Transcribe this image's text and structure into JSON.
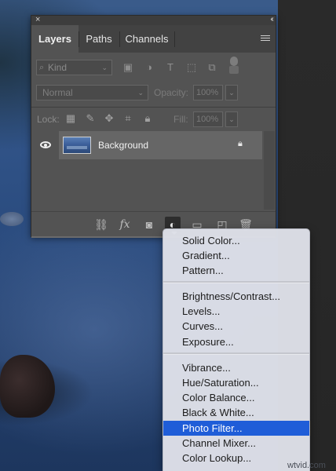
{
  "panel": {
    "close_glyph": "×",
    "collapse_glyph": "‹‹",
    "tabs": [
      {
        "label": "Layers",
        "active": true
      },
      {
        "label": "Paths",
        "active": false
      },
      {
        "label": "Channels",
        "active": false
      }
    ],
    "filter": {
      "kind_label": "Kind",
      "icons": [
        "image-filter-icon",
        "adjustment-filter-icon",
        "type-filter-icon",
        "shape-filter-icon",
        "smart-object-filter-icon"
      ]
    },
    "blend": {
      "mode": "Normal",
      "opacity_label": "Opacity:",
      "opacity_value": "100%"
    },
    "lock": {
      "label": "Lock:",
      "fill_label": "Fill:",
      "fill_value": "100%"
    },
    "layers": [
      {
        "name": "Background",
        "visible": true,
        "locked": true
      }
    ],
    "bottom_icons": [
      "link-layers-icon",
      "fx-icon",
      "add-mask-icon",
      "new-adjustment-layer-icon",
      "new-group-icon",
      "new-layer-icon",
      "delete-layer-icon"
    ],
    "fx_label": "fx"
  },
  "menu": {
    "groups": [
      [
        "Solid Color...",
        "Gradient...",
        "Pattern..."
      ],
      [
        "Brightness/Contrast...",
        "Levels...",
        "Curves...",
        "Exposure..."
      ],
      [
        "Vibrance...",
        "Hue/Saturation...",
        "Color Balance...",
        "Black & White...",
        "Photo Filter...",
        "Channel Mixer...",
        "Color Lookup..."
      ]
    ],
    "selected": "Photo Filter...",
    "selected_color": "#1f5dd8"
  },
  "watermark": "wtvid.com"
}
